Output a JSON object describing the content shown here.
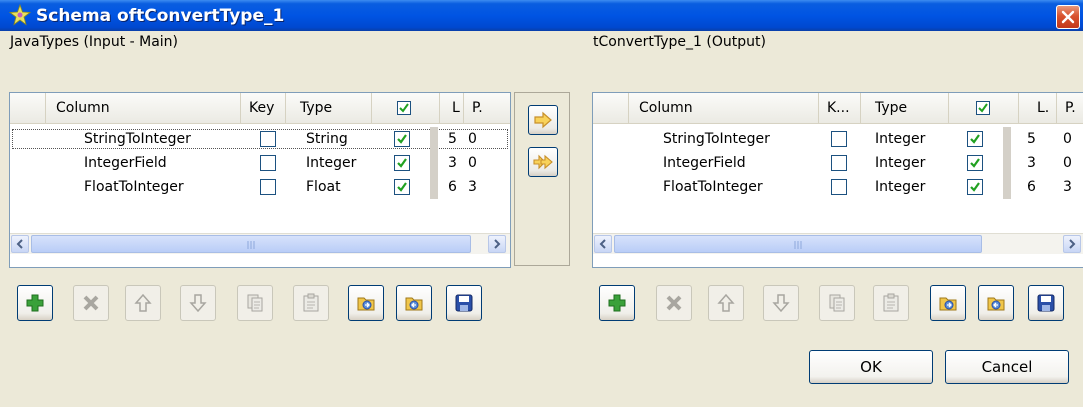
{
  "window": {
    "title": "Schema oftConvertType_1"
  },
  "input_panel": {
    "label": "JavaTypes (Input - Main)",
    "headers": {
      "column": "Column",
      "key": "Key",
      "type": "Type",
      "length": "L",
      "precision": "P."
    },
    "rows": [
      {
        "column": "StringToInteger",
        "key": false,
        "type": "String",
        "nullable": true,
        "length": "5",
        "precision": "0"
      },
      {
        "column": "IntegerField",
        "key": false,
        "type": "Integer",
        "nullable": true,
        "length": "3",
        "precision": "0"
      },
      {
        "column": "FloatToInteger",
        "key": false,
        "type": "Float",
        "nullable": true,
        "length": "6",
        "precision": "3"
      }
    ]
  },
  "output_panel": {
    "label": "tConvertType_1 (Output)",
    "headers": {
      "column": "Column",
      "key": "K...",
      "type": "Type",
      "length": "L.",
      "precision": "P."
    },
    "rows": [
      {
        "column": "StringToInteger",
        "key": false,
        "type": "Integer",
        "nullable": true,
        "length": "5",
        "precision": "0"
      },
      {
        "column": "IntegerField",
        "key": false,
        "type": "Integer",
        "nullable": true,
        "length": "3",
        "precision": "0"
      },
      {
        "column": "FloatToInteger",
        "key": false,
        "type": "Integer",
        "nullable": true,
        "length": "6",
        "precision": "3"
      }
    ]
  },
  "toolbar_icons": [
    "add-icon",
    "remove-icon",
    "move-up-icon",
    "move-down-icon",
    "copy-icon",
    "paste-icon",
    "import-icon",
    "export-icon",
    "save-icon"
  ],
  "buttons": {
    "ok": "OK",
    "cancel": "Cancel"
  },
  "colors": {
    "title_bar": "#0054e3",
    "close": "#d9532f",
    "check": "#21a121",
    "add": "#3aa13a",
    "folder": "#f0c64a",
    "save": "#2a4fa8"
  }
}
